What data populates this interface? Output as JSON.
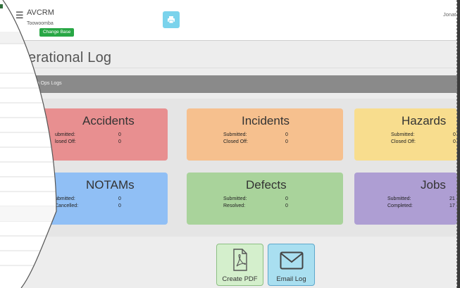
{
  "header": {
    "app_name": "AVCRM",
    "base_name": "Toowoomba",
    "change_base_label": "Change Base",
    "user_name": "Jonat"
  },
  "page": {
    "title": "erational Log",
    "search_label": "rch Ops Logs"
  },
  "cards": {
    "accidents": {
      "title": "Accidents",
      "row1_label": "ubmitted:",
      "row1_value": "0",
      "row2_label": "losed Off:",
      "row2_value": "0"
    },
    "incidents": {
      "title": "Incidents",
      "row1_label": "Submitted:",
      "row1_value": "0",
      "row2_label": "Closed Off:",
      "row2_value": "0"
    },
    "hazards": {
      "title": "Hazards",
      "row1_label": "Submitted:",
      "row1_value": "0",
      "row2_label": "Closed Off:",
      "row2_value": "0"
    },
    "notams": {
      "title": "NOTAMs",
      "row1_label": "ubmitted:",
      "row1_value": "0",
      "row2_label": "Cancelled:",
      "row2_value": "0"
    },
    "defects": {
      "title": "Defects",
      "row1_label": "Submitted:",
      "row1_value": "0",
      "row2_label": "Resolved:",
      "row2_value": "0"
    },
    "jobs": {
      "title": "Jobs",
      "row1_label": "Submitted:",
      "row1_value": "21",
      "row2_label": "Completed:",
      "row2_value": "17"
    }
  },
  "buttons": {
    "create_pdf": "Create PDF",
    "email_log": "Email Log"
  },
  "icons": {
    "menu": "hamburger-menu-icon",
    "printer": "printer-icon",
    "pdf": "pdf-file-icon",
    "email": "envelope-icon"
  },
  "colors": {
    "accidents": "#e88f90",
    "incidents": "#f6c08e",
    "hazards": "#f8dd8e",
    "notams": "#90bff5",
    "defects": "#a9d39b",
    "jobs": "#ae9ed3",
    "change_base": "#28a745"
  }
}
